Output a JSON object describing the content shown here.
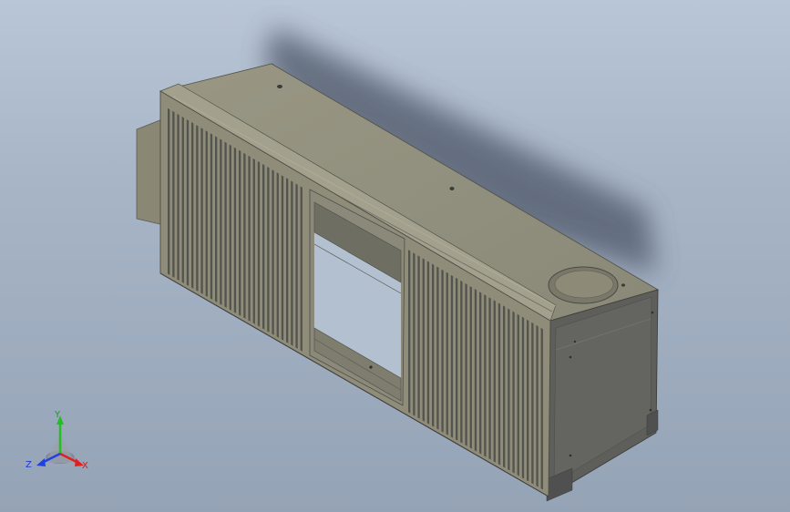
{
  "viewport": {
    "background_top": "#b9c6d6",
    "background_bottom": "#95a3b6"
  },
  "model": {
    "name_icon": "sheet-metal-housing-3d-model",
    "body_color": "#8f8d7a",
    "face_light": "#9d9b88",
    "face_dark": "#5f5f5c",
    "fin_color": "#4a4a47"
  },
  "triad": {
    "x_label": "X",
    "y_label": "Y",
    "z_label": "Z",
    "x_color": "#e02020",
    "y_color": "#20c020",
    "z_color": "#2040e0"
  }
}
